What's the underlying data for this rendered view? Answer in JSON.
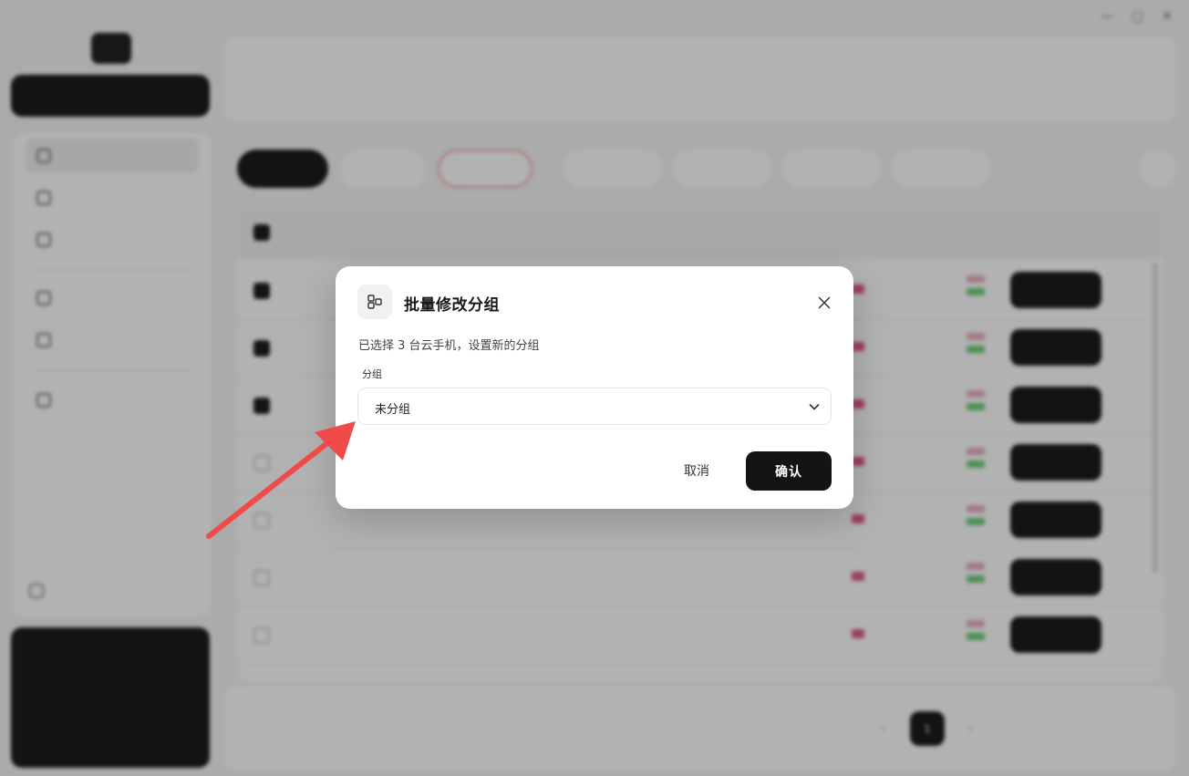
{
  "dialog": {
    "title": "批量修改分组",
    "icon": "group-icon",
    "description": "已选择 3 台云手机，设置新的分组",
    "field_label": "分组",
    "selected_group": "未分组",
    "cancel_label": "取消",
    "confirm_label": "确认"
  },
  "colors": {
    "primary": "#141414",
    "annotation_arrow": "#f04a4a",
    "delete_outline": "#f0a0a0"
  },
  "table": {
    "selected_rows": [
      1,
      2,
      3
    ],
    "row_count": 7
  },
  "pagination": {
    "current_page": "1"
  }
}
